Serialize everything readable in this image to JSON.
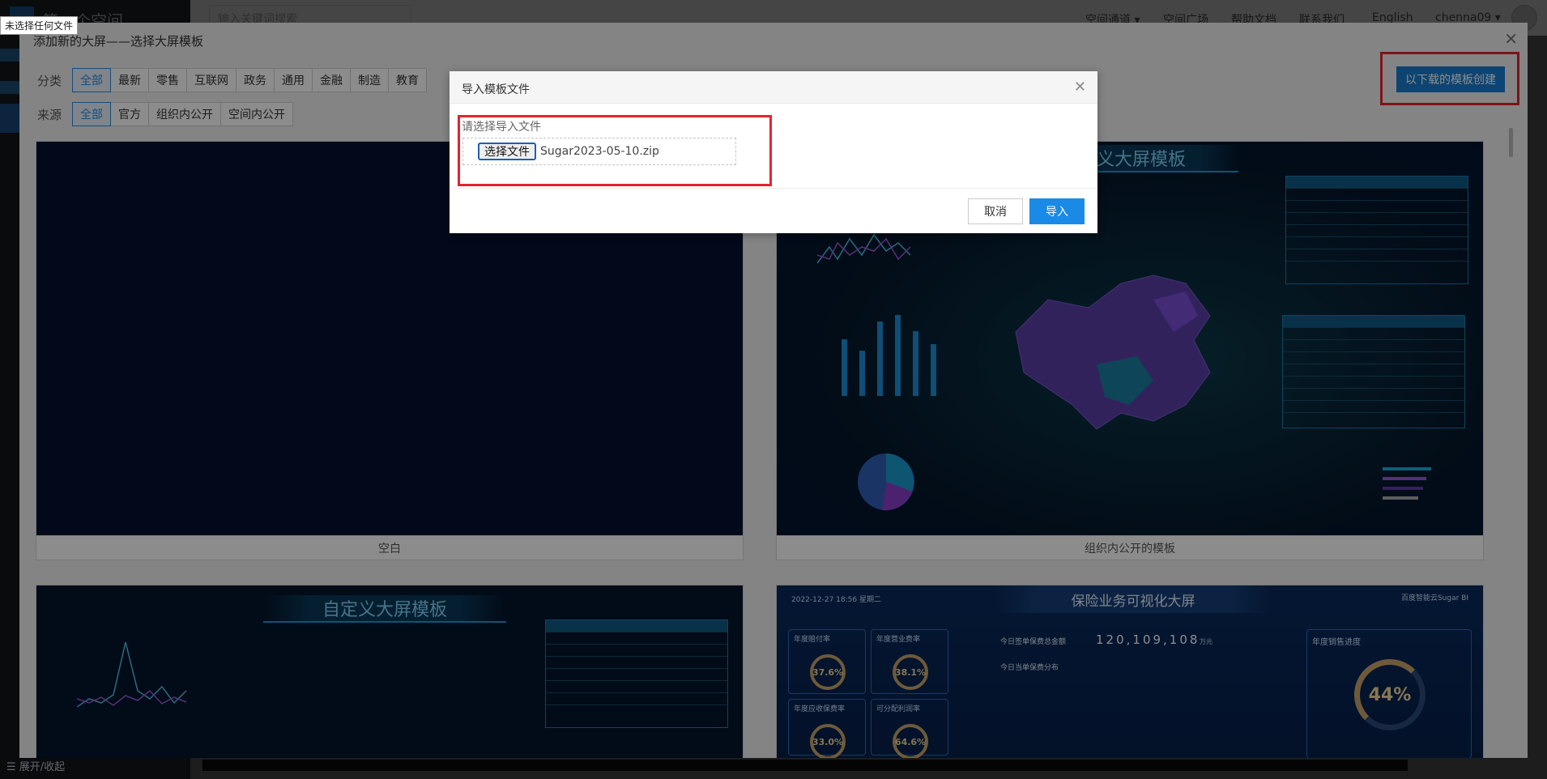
{
  "tooltip": {
    "text": "未选择任何文件"
  },
  "background": {
    "space_title": "第一个空间",
    "search_placeholder": "输入关键词搜索",
    "nav": [
      "空间通道 ▾",
      "空间广场",
      "帮助文档",
      "联系我们",
      "English",
      "chenna09 ▾"
    ],
    "bottom_toggle": "☰  展开/收起"
  },
  "template_dialog": {
    "title": "添加新的大屏——选择大屏模板",
    "category_label": "分类",
    "categories": [
      "全部",
      "最新",
      "零售",
      "互联网",
      "政务",
      "通用",
      "金融",
      "制造",
      "教育"
    ],
    "source_label": "来源",
    "sources": [
      "全部",
      "官方",
      "组织内公开",
      "空间内公开"
    ],
    "create_from_download": "以下载的模板创建",
    "cards": [
      {
        "label": "空白"
      },
      {
        "label": "组织内公开的模板",
        "banner": "义大屏模板"
      },
      {
        "banner": "自定义大屏模板"
      },
      {
        "banner": "保险业务可视化大屏",
        "datetime": "2022-12-27 18:56 星期二",
        "brand": "百度智能云Sugar BI",
        "kpis": [
          {
            "label": "年度赔付率",
            "value": "37.6%"
          },
          {
            "label": "年度营业费率",
            "value": "38.1%"
          },
          {
            "label": "年度应收保费率",
            "value": "33.0%"
          },
          {
            "label": "可分配利润率",
            "value": "64.6%"
          }
        ],
        "total_label": "今日签单保费总金额",
        "total_value": "120,109,108",
        "total_unit": "万元",
        "dist_label": "今日当单保费分布",
        "progress_label": "年度销售进度",
        "progress_value": "44%"
      }
    ]
  },
  "import_dialog": {
    "title": "导入模板文件",
    "prompt": "请选择导入文件",
    "choose_file": "选择文件",
    "file_name": "Sugar2023-05-10.zip",
    "cancel": "取消",
    "import": "导入"
  },
  "colors": {
    "accent": "#1a8ae6",
    "highlight": "#e8222f",
    "thumb_bg": "#041230"
  }
}
